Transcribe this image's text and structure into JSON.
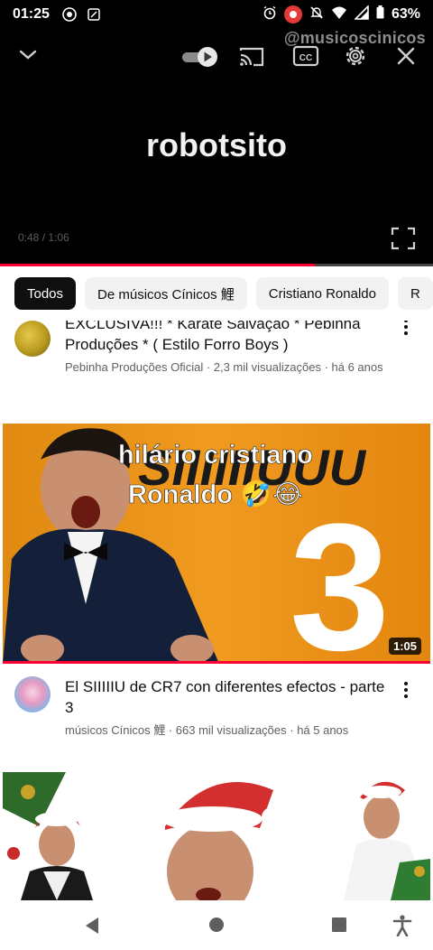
{
  "status_bar": {
    "time": "01:25",
    "battery": "63%"
  },
  "player": {
    "watermark": "@musicoscinicos",
    "caption": "robotsito",
    "time": "0:48 / 1:06",
    "progress": 0.727
  },
  "chips": [
    {
      "label": "Todos"
    },
    {
      "label": "De músicos Cínicos 鯉"
    },
    {
      "label": "Cristiano Ronaldo"
    },
    {
      "label": "R"
    }
  ],
  "feed": {
    "item1": {
      "title": "EXCLUSIVA!!! * Karate Salvação * Pebinha Produções * ( Estilo Forro Boys )",
      "channel": "Pebinha Produções Oficial · 2,3 mil visualizações · há 6 anos"
    },
    "item2": {
      "thumb_text_1": "hilário cristiano",
      "thumb_text_2": "Ronaldo 🤣😂",
      "thumb_big_text": "SIIIIIIUUU",
      "thumb_number": "3",
      "duration": "1:05",
      "title": "El SIIIIIU de CR7 con diferentes efectos - parte 3",
      "channel": "músicos Cínicos 鯉 · 663 mil visualizações · há 5 anos"
    }
  }
}
